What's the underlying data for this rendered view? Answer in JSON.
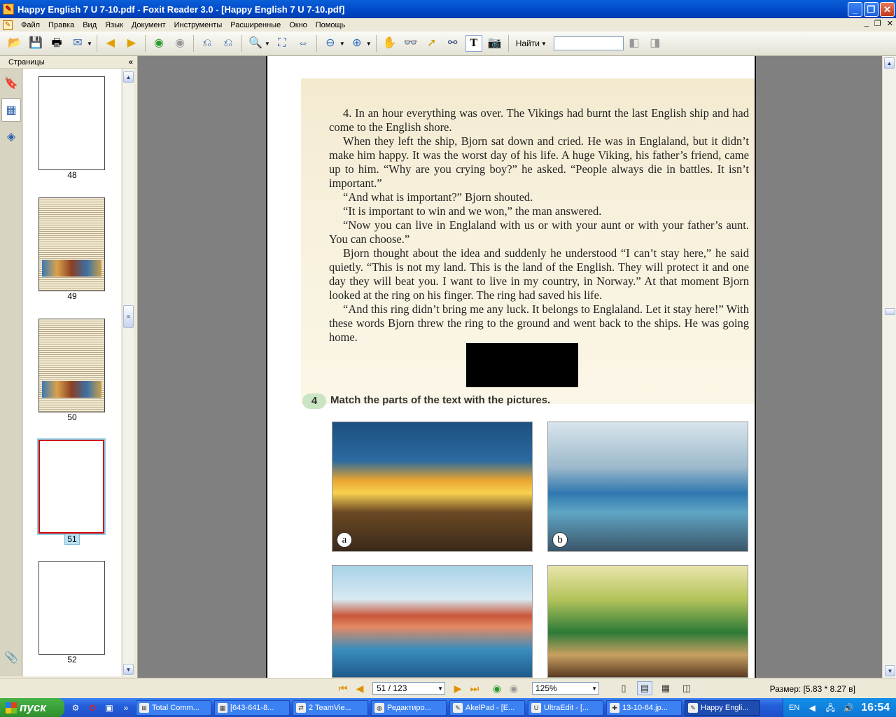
{
  "window": {
    "title": "Happy English 7 U 7-10.pdf - Foxit Reader 3.0 - [Happy English 7 U 7-10.pdf]",
    "controls": {
      "minimize": "_",
      "maximize": "❐",
      "close": "✕"
    }
  },
  "menu": {
    "items": [
      "Файл",
      "Правка",
      "Вид",
      "Язык",
      "Документ",
      "Инструменты",
      "Расширенные",
      "Окно",
      "Помощь"
    ],
    "mdi_controls": [
      "_",
      "❐",
      "✕"
    ]
  },
  "toolbar": {
    "find_label": "Найти",
    "find_value": "",
    "icons": [
      "open-icon",
      "save-icon",
      "print-icon",
      "email-icon",
      "back-icon",
      "forward-icon",
      "prev-view-icon",
      "next-view-icon",
      "rotate-left-icon",
      "rotate-right-icon",
      "zoom-in-icon",
      "fit-page-icon",
      "fit-width-icon",
      "zoom-out-icon",
      "zoom-plus-icon",
      "hand-icon",
      "loupe-icon",
      "select-arrow-icon",
      "binoculars-icon",
      "text-select-icon",
      "snapshot-icon"
    ]
  },
  "sidebar": {
    "header": "Страницы",
    "collapse_glyph": "«",
    "thumbnails": [
      {
        "label": "48",
        "selected": false,
        "content": "blank"
      },
      {
        "label": "49",
        "selected": false,
        "content": "text-with-picture"
      },
      {
        "label": "50",
        "selected": false,
        "content": "text-with-picture"
      },
      {
        "label": "51",
        "selected": true,
        "content": "blank"
      },
      {
        "label": "52",
        "selected": false,
        "content": "blank"
      }
    ]
  },
  "document": {
    "paragraphs": [
      "4. In an hour everything was over. The Vikings had burnt the last English ship and had come to the English shore.",
      "When they left the ship, Bjorn sat down and cried. He was in Englaland, but it didn’t make him happy. It was the worst day of his life. A huge Viking, his father’s friend, came up to him. “Why are you crying boy?” he asked. “People always die in battles. It isn’t important.”",
      "“And what is important?” Bjorn shouted.",
      "“It is important to win and we won,” the man answered.",
      "“Now you can live in Englaland with us or with your aunt or with your father’s aunt. You can choose.”",
      "Bjorn thought about the idea and suddenly he understood “I can’t stay here,” he said quietly. “This is not my land. This is the land of the English. They will protect it and one day they will beat you. I want to live in my country, in Norway.” At that moment Bjorn looked at the ring on his finger. The ring had saved his life.",
      "“And this ring didn’t bring me any luck. It belongs to Englaland. Let it stay here!” With these words Bjorn threw the ring to the ground and went back to the ships. He was going home."
    ],
    "exercise_number": "4",
    "exercise_text": "Match the parts of the text with the pictures.",
    "picture_labels": [
      "a",
      "b"
    ]
  },
  "statusbar": {
    "page_value": "51 / 123",
    "zoom_value": "125%",
    "size_text": "Размер: [5.83 * 8.27 в]"
  },
  "taskbar": {
    "start_label": "пуск",
    "tasks": [
      {
        "label": "Total Comm...",
        "active": false
      },
      {
        "label": "[643-641-8...",
        "active": false
      },
      {
        "label": "2 TeamVie...",
        "active": false
      },
      {
        "label": "Редактиро...",
        "active": false
      },
      {
        "label": "AkelPad - [E...",
        "active": false
      },
      {
        "label": "UltraEdit - [...",
        "active": false
      },
      {
        "label": "13-10-64.jp...",
        "active": false
      },
      {
        "label": "Happy Engli...",
        "active": true
      }
    ],
    "tray": {
      "lang": "EN",
      "clock": "16:54"
    }
  }
}
